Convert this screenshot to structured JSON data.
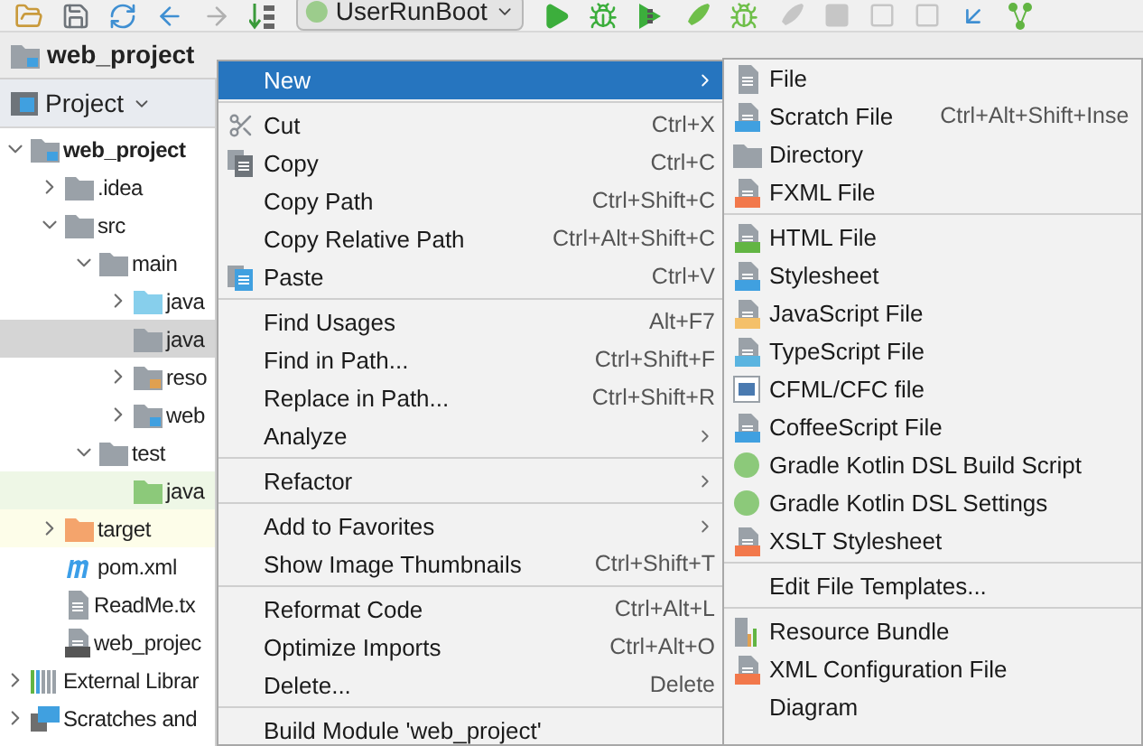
{
  "toolbar": {
    "run_configuration": "UserRunBoot"
  },
  "breadcrumbs": [
    {
      "label": "web_project"
    }
  ],
  "project_panel": {
    "title": "Project",
    "tree": [
      {
        "label": "web_project",
        "kind": "module",
        "expanded": true,
        "selected": false,
        "children": [
          {
            "label": ".idea",
            "kind": "folder",
            "expanded": false,
            "selected": false
          },
          {
            "label": "src",
            "kind": "folder",
            "expanded": true,
            "selected": false,
            "children": [
              {
                "label": "main",
                "kind": "folder",
                "expanded": true,
                "selected": false,
                "children": [
                  {
                    "label": "java",
                    "kind": "source",
                    "expanded": false,
                    "selected": false
                  },
                  {
                    "label": "java",
                    "kind": "folder",
                    "selected": true
                  },
                  {
                    "label": "reso",
                    "kind": "resources",
                    "expanded": false,
                    "selected": false
                  },
                  {
                    "label": "web",
                    "kind": "web",
                    "expanded": false,
                    "selected": false
                  }
                ]
              },
              {
                "label": "test",
                "kind": "folder",
                "expanded": true,
                "selected": false,
                "children": [
                  {
                    "label": "java",
                    "kind": "test_source",
                    "selected": false,
                    "color": "#eef7e6"
                  }
                ]
              }
            ]
          },
          {
            "label": "target",
            "kind": "excluded",
            "expanded": false,
            "selected": false,
            "color": "#fdfde9"
          },
          {
            "label": "pom.xml",
            "kind": "maven",
            "selected": false
          },
          {
            "label": "ReadMe.tx",
            "kind": "text",
            "selected": false
          },
          {
            "label": "web_projec",
            "kind": "iml",
            "selected": false
          }
        ]
      },
      {
        "label": "External Librar",
        "kind": "libraries",
        "expanded": false,
        "selected": false
      },
      {
        "label": "Scratches and",
        "kind": "scratches",
        "expanded": false,
        "selected": false
      }
    ]
  },
  "context_menu": {
    "groups": [
      [
        {
          "label": "New",
          "submenu": true,
          "selected": true
        }
      ],
      [
        {
          "label": "Cut",
          "shortcut": "Ctrl+X",
          "submenu": false,
          "selected": false
        },
        {
          "label": "Copy",
          "shortcut": "Ctrl+C",
          "submenu": false,
          "selected": false
        },
        {
          "label": "Copy Path",
          "shortcut": "Ctrl+Shift+C",
          "submenu": false,
          "selected": false
        },
        {
          "label": "Copy Relative Path",
          "shortcut": "Ctrl+Alt+Shift+C",
          "submenu": false,
          "selected": false
        },
        {
          "label": "Paste",
          "shortcut": "Ctrl+V",
          "submenu": false,
          "selected": false
        }
      ],
      [
        {
          "label": "Find Usages",
          "shortcut": "Alt+F7",
          "submenu": false,
          "selected": false
        },
        {
          "label": "Find in Path...",
          "shortcut": "Ctrl+Shift+F",
          "submenu": false,
          "selected": false
        },
        {
          "label": "Replace in Path...",
          "shortcut": "Ctrl+Shift+R",
          "submenu": false,
          "selected": false
        },
        {
          "label": "Analyze",
          "submenu": true,
          "selected": false
        }
      ],
      [
        {
          "label": "Refactor",
          "submenu": true,
          "selected": false
        }
      ],
      [
        {
          "label": "Add to Favorites",
          "submenu": true,
          "selected": false
        },
        {
          "label": "Show Image Thumbnails",
          "shortcut": "Ctrl+Shift+T",
          "submenu": false,
          "selected": false
        }
      ],
      [
        {
          "label": "Reformat Code",
          "shortcut": "Ctrl+Alt+L",
          "submenu": false,
          "selected": false
        },
        {
          "label": "Optimize Imports",
          "shortcut": "Ctrl+Alt+O",
          "submenu": false,
          "selected": false
        },
        {
          "label": "Delete...",
          "shortcut": "Delete",
          "submenu": false,
          "selected": false
        }
      ],
      [
        {
          "label": "Build Module 'web_project'",
          "submenu": false,
          "selected": false
        }
      ]
    ]
  },
  "new_submenu": {
    "groups": [
      [
        {
          "label": "File"
        },
        {
          "label": "Scratch File",
          "shortcut": "Ctrl+Alt+Shift+Inse"
        },
        {
          "label": "Directory"
        },
        {
          "label": "FXML File"
        }
      ],
      [
        {
          "label": "HTML File"
        },
        {
          "label": "Stylesheet"
        },
        {
          "label": "JavaScript File"
        },
        {
          "label": "TypeScript File"
        },
        {
          "label": "CFML/CFC file"
        },
        {
          "label": "CoffeeScript File"
        },
        {
          "label": "Gradle Kotlin DSL Build Script"
        },
        {
          "label": "Gradle Kotlin DSL Settings"
        },
        {
          "label": "XSLT Stylesheet"
        }
      ],
      [
        {
          "label": "Edit File Templates..."
        }
      ],
      [
        {
          "label": "Resource Bundle"
        },
        {
          "label": "XML Configuration File"
        },
        {
          "label": "Diagram"
        }
      ]
    ]
  }
}
